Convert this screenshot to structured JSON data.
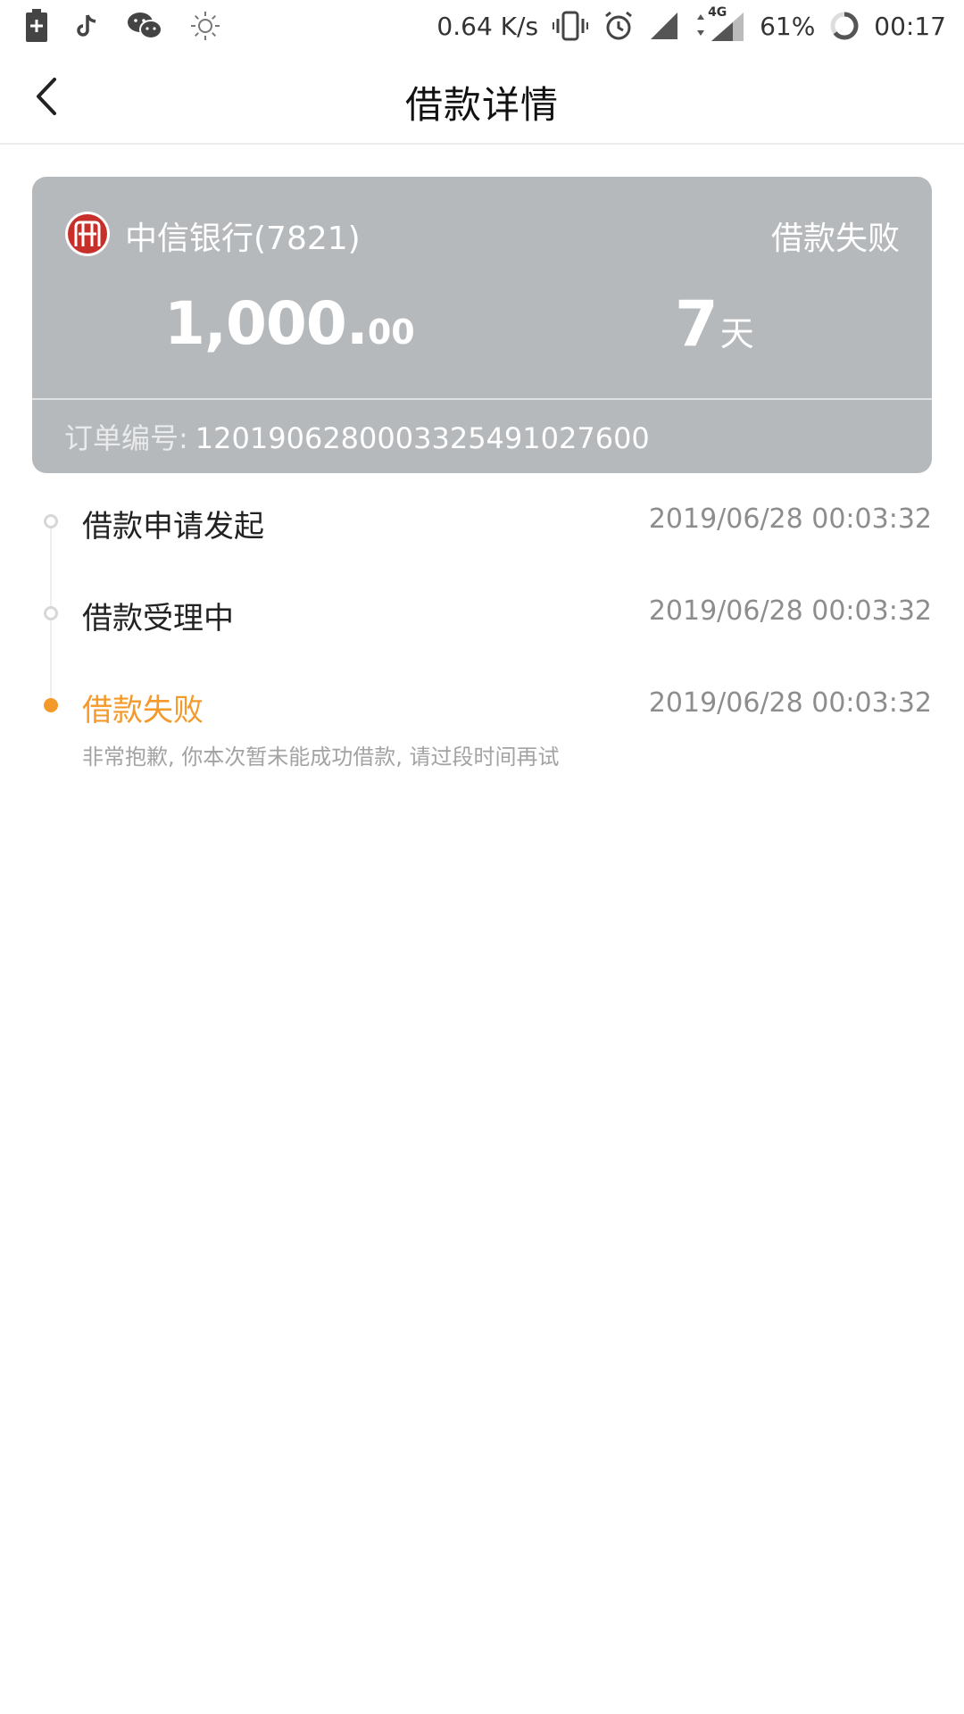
{
  "status_bar": {
    "network_speed": "0.64 K/s",
    "network_type": "4G",
    "battery_percent": "61%",
    "time": "00:17",
    "icons_left": [
      "battery-saver-icon",
      "tiktok-icon",
      "wechat-icon",
      "brightness-icon"
    ],
    "icons_right": [
      "vibrate-icon",
      "alarm-icon",
      "signal-icon",
      "mobile-data-icon",
      "battery-ring-icon"
    ]
  },
  "header": {
    "title": "借款详情",
    "back_icon": "chevron-left-icon"
  },
  "loan_card": {
    "bank_name": "中信银行(7821)",
    "status": "借款失败",
    "amount_integer": "1,000.",
    "amount_decimal": "00",
    "term_value": "7",
    "term_unit": "天",
    "order_label": "订单编号:",
    "order_number": "1201906280003325491027600",
    "card_color": "#b6b9bc",
    "bank_logo_color": "#c7302a"
  },
  "timeline": {
    "accent_color": "#f39a2b",
    "steps": [
      {
        "title": "借款申请发起",
        "time": "2019/06/28 00:03:32",
        "state": "done"
      },
      {
        "title": "借款受理中",
        "time": "2019/06/28 00:03:32",
        "state": "done"
      },
      {
        "title": "借款失败",
        "time": "2019/06/28 00:03:32",
        "state": "current",
        "note": "非常抱歉, 你本次暂未能成功借款, 请过段时间再试"
      }
    ]
  }
}
